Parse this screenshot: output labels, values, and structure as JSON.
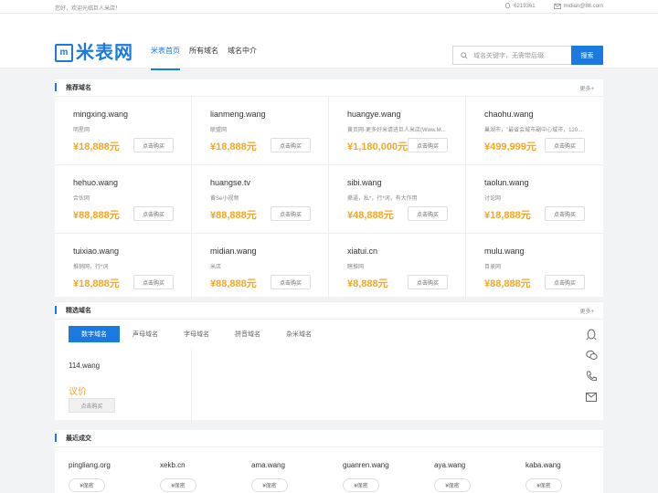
{
  "topbar": {
    "welcome": "您好，欢迎光临巨人米店！",
    "qq": "6219361",
    "email": "midian@88.com"
  },
  "logo": {
    "mark": "m",
    "text": "米表网"
  },
  "nav": [
    {
      "label": "米表首页",
      "active": true
    },
    {
      "label": "所有域名",
      "active": false
    },
    {
      "label": "域名中介",
      "active": false
    }
  ],
  "search": {
    "placeholder": "域名关键字，无需带后缀",
    "button": "搜索"
  },
  "recommended": {
    "title": "推荐域名",
    "more": "更多+",
    "items": [
      {
        "domain": "mingxing.wang",
        "desc": "明星网",
        "price": "¥18,888元",
        "buy": "点击购买"
      },
      {
        "domain": "lianmeng.wang",
        "desc": "联盟网",
        "price": "¥18,888元",
        "buy": "点击购买"
      },
      {
        "domain": "huangye.wang",
        "desc": "黄页网-更多好米请进巨人米店(Www.M...",
        "price": "¥1,180,000元",
        "buy": "点击购买"
      },
      {
        "domain": "chaohu.wang",
        "desc": "巢湖市，\"最省会城市副中心城市，120...",
        "price": "¥499,999元",
        "buy": "点击购买"
      },
      {
        "domain": "hehuo.wang",
        "desc": "合伙网",
        "price": "¥88,888元",
        "buy": "点击购买"
      },
      {
        "domain": "huangse.tv",
        "desc": "黄Se小视频",
        "price": "¥88,888元",
        "buy": "点击购买"
      },
      {
        "domain": "sibi.wang",
        "desc": "撕逼，私*，行*词，有大作用",
        "price": "¥48,888元",
        "buy": "点击购买"
      },
      {
        "domain": "taolun.wang",
        "desc": "讨论网",
        "price": "¥18,888元",
        "buy": "点击购买"
      },
      {
        "domain": "tuixiao.wang",
        "desc": "推销网，行*词",
        "price": "¥18,888元",
        "buy": "点击购买"
      },
      {
        "domain": "midian.wang",
        "desc": "米店",
        "price": "¥88,888元",
        "buy": "点击购买"
      },
      {
        "domain": "xiatui.cn",
        "desc": "瞎推网",
        "price": "¥8,888元",
        "buy": "点击购买"
      },
      {
        "domain": "mulu.wang",
        "desc": "目录网",
        "price": "¥88,888元",
        "buy": "点击购买"
      }
    ]
  },
  "selected": {
    "title": "精选域名",
    "more": "更多+",
    "tabs": [
      {
        "label": "数字域名",
        "active": true
      },
      {
        "label": "声母域名",
        "active": false
      },
      {
        "label": "字母域名",
        "active": false
      },
      {
        "label": "拼音域名",
        "active": false
      },
      {
        "label": "杂米域名",
        "active": false
      }
    ],
    "item": {
      "domain": "114.wang",
      "price": "议价",
      "buy": "点击购买"
    }
  },
  "recent": {
    "title": "最近成交",
    "items": [
      {
        "domain": "pingliang.org",
        "price": "¥保密"
      },
      {
        "domain": "xekb.cn",
        "price": "¥保密"
      },
      {
        "domain": "ama.wang",
        "price": "¥保密"
      },
      {
        "domain": "guanren.wang",
        "price": "¥保密"
      },
      {
        "domain": "aya.wang",
        "price": "¥保密"
      },
      {
        "domain": "kaba.wang",
        "price": "¥保密"
      }
    ]
  },
  "side_icons": [
    "qq-icon",
    "wechat-icon",
    "phone-icon",
    "mail-icon"
  ],
  "colors": {
    "accent": "#1a7ae0",
    "price": "#f5a623"
  }
}
